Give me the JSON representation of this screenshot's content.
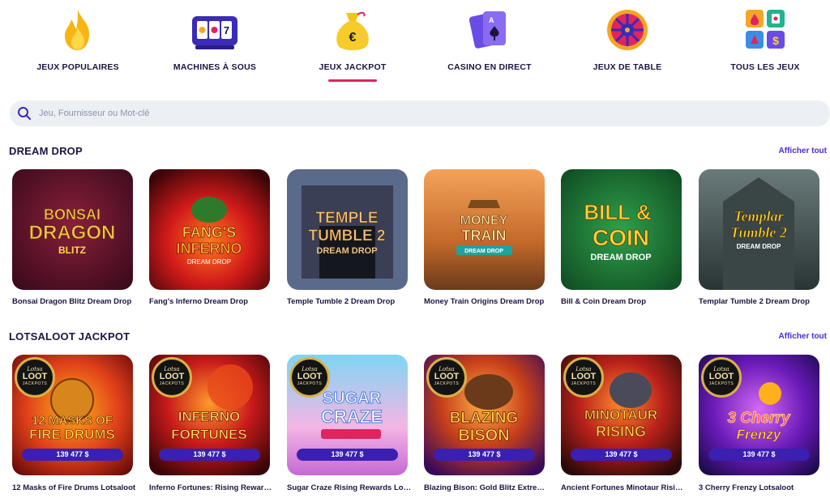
{
  "nav": {
    "categories": [
      {
        "label": "JEUX POPULAIRES",
        "icon": "flame-icon"
      },
      {
        "label": "MACHINES À SOUS",
        "icon": "slot-machine-icon"
      },
      {
        "label": "JEUX JACKPOT",
        "icon": "money-bag-icon",
        "active": true
      },
      {
        "label": "CASINO EN DIRECT",
        "icon": "playing-cards-icon"
      },
      {
        "label": "JEUX DE TABLE",
        "icon": "roulette-wheel-icon"
      },
      {
        "label": "TOUS LES JEUX",
        "icon": "all-games-grid-icon"
      }
    ]
  },
  "search": {
    "placeholder": "Jeu, Fournisseur ou Mot-clé",
    "icon": "search-icon"
  },
  "sections": [
    {
      "title": "DREAM DROP",
      "see_all": "Afficher tout",
      "games": [
        {
          "name": "Bonsai Dragon Blitz Dream Drop",
          "art": [
            "BONSAI",
            "DRAGON",
            "BLITZ"
          ]
        },
        {
          "name": "Fang's Inferno Dream Drop",
          "art": [
            "FANG'S",
            "INFERNO",
            "DREAM DROP"
          ]
        },
        {
          "name": "Temple Tumble 2 Dream Drop",
          "art": [
            "TEMPLE",
            "TUMBLE 2",
            "DREAM DROP"
          ]
        },
        {
          "name": "Money Train Origins Dream Drop",
          "art": [
            "MONEY",
            "TRAIN",
            "DREAM DROP"
          ]
        },
        {
          "name": "Bill & Coin Dream Drop",
          "art": [
            "BILL &",
            "COIN",
            "DREAM DROP"
          ]
        },
        {
          "name": "Templar Tumble 2 Dream Drop",
          "art": [
            "Templar",
            "Tumble 2",
            "DREAM DROP"
          ]
        }
      ]
    },
    {
      "title": "LOTSALOOT JACKPOT",
      "see_all": "Afficher tout",
      "badge": {
        "line1": "Lotsa",
        "line2": "LOOT",
        "line3": "JACKPOTS"
      },
      "games": [
        {
          "name": "12 Masks of Fire Drums Lotsaloot",
          "jackpot": "139 477 $",
          "art": [
            "12 MASKS OF",
            "FIRE DRUMS"
          ]
        },
        {
          "name": "Inferno Fortunes: Rising Rewards Lotsaloot",
          "jackpot": "139 477 $",
          "art": [
            "INFERNO",
            "FORTUNES"
          ]
        },
        {
          "name": "Sugar Craze Rising Rewards Lotsaloot",
          "jackpot": "139 477 $",
          "art": [
            "SUGAR",
            "CRAZE"
          ]
        },
        {
          "name": "Blazing Bison: Gold Blitz Extreme Lotsaloot",
          "jackpot": "139 477 $",
          "art": [
            "BLAZING",
            "BISON"
          ]
        },
        {
          "name": "Ancient Fortunes Minotaur Rising Lotsaloot",
          "jackpot": "139 477 $",
          "art": [
            "MINOTAUR",
            "RISING"
          ]
        },
        {
          "name": "3 Cherry Frenzy Lotsaloot",
          "jackpot": "139 477 $",
          "art": [
            "3 Cherry",
            "Frenzy"
          ]
        }
      ]
    }
  ],
  "colors": {
    "accent": "#e0245e",
    "link": "#4a2bd6",
    "text": "#1a1540",
    "pill": "#3b1fb0"
  }
}
